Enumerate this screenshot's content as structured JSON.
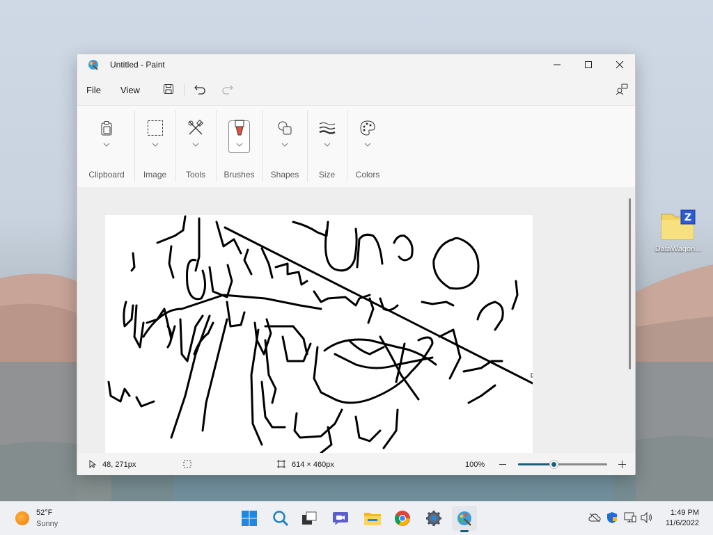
{
  "window": {
    "title": "Untitled - Paint",
    "menu": {
      "file": "File",
      "view": "View"
    }
  },
  "ribbon": {
    "groups": [
      {
        "label": "Clipboard",
        "icon": "clipboard-icon"
      },
      {
        "label": "Image",
        "icon": "selection-icon"
      },
      {
        "label": "Tools",
        "icon": "tools-icon"
      },
      {
        "label": "Brushes",
        "icon": "brush-icon"
      },
      {
        "label": "Shapes",
        "icon": "shapes-icon"
      },
      {
        "label": "Size",
        "icon": "size-icon"
      },
      {
        "label": "Colors",
        "icon": "palette-icon"
      }
    ]
  },
  "status": {
    "cursor_pos": "48, 271px",
    "canvas_size": "614 × 460px",
    "zoom": "100%",
    "zoom_level": 0.4
  },
  "desktop": {
    "icon_label": "DataWagon..."
  },
  "taskbar": {
    "temp": "52°F",
    "condition": "Sunny",
    "time": "1:49 PM",
    "date": "11/6/2022",
    "apps": [
      "start-icon",
      "search-icon",
      "task-view-icon",
      "chat-icon",
      "file-explorer-icon",
      "chrome-icon",
      "settings-icon",
      "paint-icon"
    ]
  },
  "colors": {
    "accent": "#1a5e7a"
  }
}
